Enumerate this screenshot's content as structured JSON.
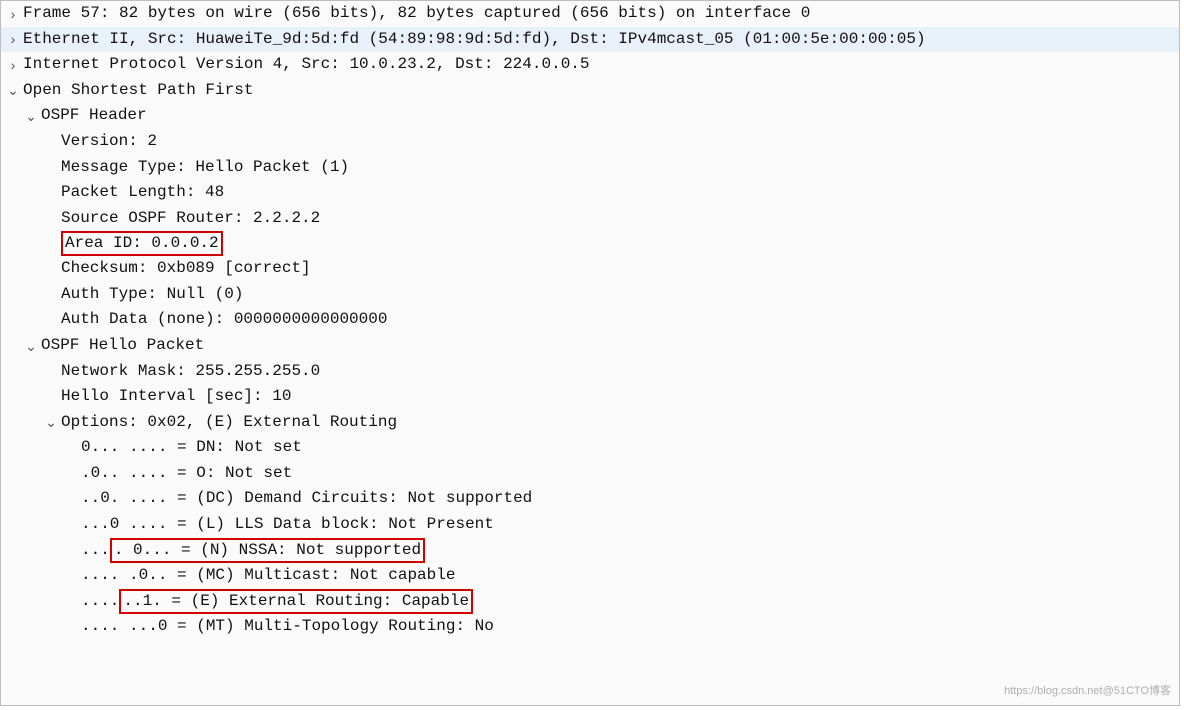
{
  "frame": "Frame 57: 82 bytes on wire (656 bits), 82 bytes captured (656 bits) on interface 0",
  "eth": "Ethernet II, Src: HuaweiTe_9d:5d:fd (54:89:98:9d:5d:fd), Dst: IPv4mcast_05 (01:00:5e:00:00:05)",
  "ip": "Internet Protocol Version 4, Src: 10.0.23.2, Dst: 224.0.0.5",
  "ospf": "Open Shortest Path First",
  "header": {
    "title": "OSPF Header",
    "version": "Version: 2",
    "msgtype": "Message Type: Hello Packet (1)",
    "pktlen": "Packet Length: 48",
    "srcrtr": "Source OSPF Router: 2.2.2.2",
    "areaid": "Area ID: 0.0.0.2",
    "cksum": "Checksum: 0xb089 [correct]",
    "authtype": "Auth Type: Null (0)",
    "authdata": "Auth Data (none): 0000000000000000"
  },
  "hello": {
    "title": "OSPF Hello Packet",
    "netmask": "Network Mask: 255.255.255.0",
    "interval": "Hello Interval [sec]: 10",
    "options": "Options: 0x02, (E) External Routing",
    "dn": "0... .... = DN: Not set",
    "o": ".0.. .... = O: Not set",
    "dc": "..0. .... = (DC) Demand Circuits: Not supported",
    "l": "...0 .... = (L) LLS Data block: Not Present",
    "n_pre": "...",
    "n_box": ". 0... = (N) NSSA: Not supported ",
    "mc": ".... .0.. = (MC) Multicast: Not capable",
    "e_pre": "....",
    "e_box": " ..1. = (E) External Routing: Capable",
    "mt": ".... ...0 = (MT) Multi-Topology Routing: No"
  },
  "watermark": "https://blog.csdn.net@51CTO博客"
}
